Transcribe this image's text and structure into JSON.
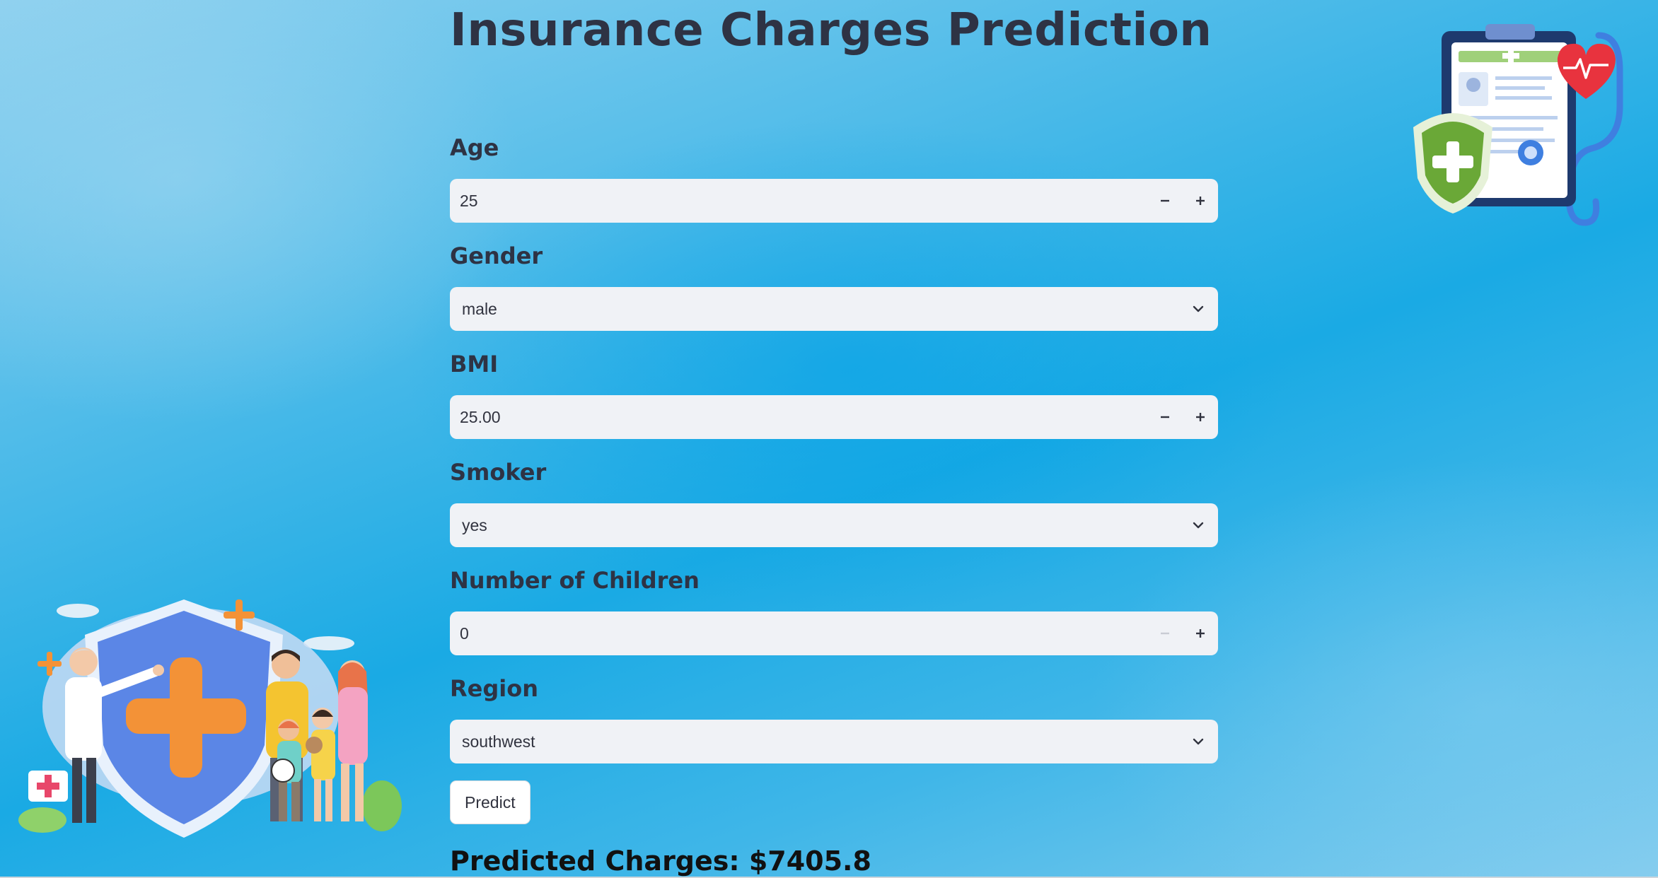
{
  "page": {
    "title": "Insurance Charges Prediction"
  },
  "form": {
    "age": {
      "label": "Age",
      "value": "25"
    },
    "gender": {
      "label": "Gender",
      "value": "male"
    },
    "bmi": {
      "label": "BMI",
      "value": "25.00"
    },
    "smoker": {
      "label": "Smoker",
      "value": "yes"
    },
    "children": {
      "label": "Number of Children",
      "value": "0"
    },
    "region": {
      "label": "Region",
      "value": "southwest"
    },
    "predict_label": "Predict"
  },
  "result": {
    "text": "Predicted Charges: $7405.8"
  },
  "icons": {
    "decrement": "minus-icon",
    "increment": "plus-icon",
    "dropdown": "chevron-down-icon",
    "illustration_left": "insurance-family-illustration",
    "illustration_right": "medical-clipboard-illustration"
  },
  "colors": {
    "text": "#2e3344",
    "input_bg": "#f0f2f6",
    "background": "#1aaae4"
  }
}
